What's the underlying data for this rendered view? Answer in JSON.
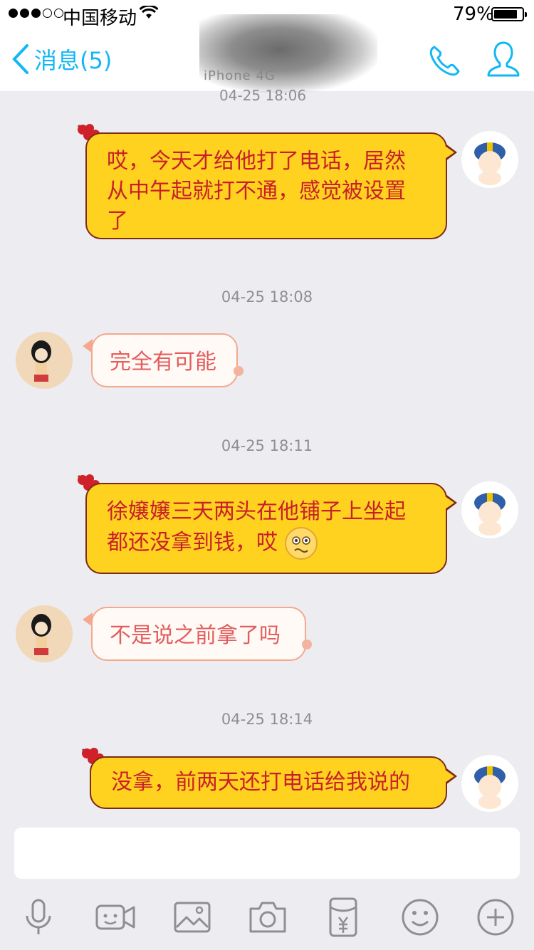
{
  "status_bar": {
    "carrier": "中国移动",
    "battery_percent": "79%"
  },
  "nav": {
    "back_label": "消息(5)",
    "contact_status": "iPhone 4G",
    "top_timestamp": "04-25 18:06"
  },
  "messages": [
    {
      "side": "me",
      "text": "哎，今天才给他打了电话，居然从中午起就打不通，感觉被设置了"
    },
    {
      "timestamp": "04-25 18:08"
    },
    {
      "side": "them",
      "text": "完全有可能"
    },
    {
      "timestamp": "04-25 18:11"
    },
    {
      "side": "me",
      "text": "徐嬢嬢三天两头在他铺子上坐起都还没拿到钱，哎",
      "emoji": "worried-face-icon"
    },
    {
      "side": "them",
      "text": "不是说之前拿了吗"
    },
    {
      "timestamp": "04-25 18:14"
    },
    {
      "side": "me",
      "text": "没拿，前两天还打电话给我说的"
    }
  ],
  "m": {
    "t1": "哎，今天才给他打了电话，居然",
    "t2": "从中午起就打不通，感觉被设置",
    "t3": "了",
    "ts2": "04-25 18:08",
    "m2": "完全有可能",
    "ts3": "04-25 18:11",
    "m3a": "徐嬢嬢三天两头在他铺子上坐起",
    "m3b": "都还没拿到钱，哎",
    "m4": "不是说之前拿了吗",
    "ts4": "04-25 18:14",
    "m5": "没拿，前两天还打电话给我说的"
  },
  "toolbar": {
    "items": [
      "microphone-icon",
      "video-call-icon",
      "image-icon",
      "camera-icon",
      "red-envelope-icon",
      "emoji-icon",
      "plus-icon"
    ]
  },
  "colors": {
    "accent": "#12b7f5",
    "my_bubble_bg": "#ffd21f",
    "my_bubble_text": "#c8202a",
    "their_bubble_text": "#e35d5d",
    "background": "#ececf1"
  }
}
